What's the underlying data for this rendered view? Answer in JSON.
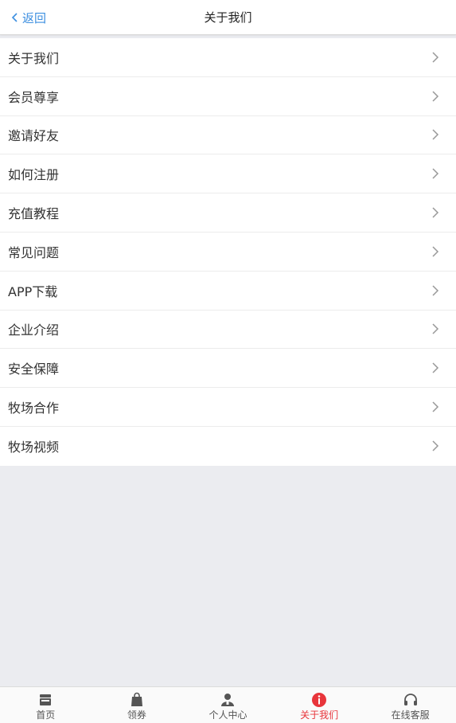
{
  "header": {
    "back_label": "返回",
    "title": "关于我们"
  },
  "menu": {
    "items": [
      {
        "label": "关于我们"
      },
      {
        "label": "会员尊享"
      },
      {
        "label": "邀请好友"
      },
      {
        "label": "如何注册"
      },
      {
        "label": "充值教程"
      },
      {
        "label": "常见问题"
      },
      {
        "label": "APP下载"
      },
      {
        "label": "企业介绍"
      },
      {
        "label": "安全保障"
      },
      {
        "label": "牧场合作"
      },
      {
        "label": "牧场视频"
      }
    ]
  },
  "tabbar": {
    "tabs": [
      {
        "label": "首页",
        "icon": "store-icon"
      },
      {
        "label": "领券",
        "icon": "shopping-bag-icon"
      },
      {
        "label": "个人中心",
        "icon": "user-icon"
      },
      {
        "label": "关于我们",
        "icon": "info-icon",
        "active": true
      },
      {
        "label": "在线客服",
        "icon": "headset-icon"
      }
    ],
    "active_color": "#e8353b"
  },
  "colors": {
    "accent": "#3d8fe0",
    "background": "#ebecf0"
  }
}
